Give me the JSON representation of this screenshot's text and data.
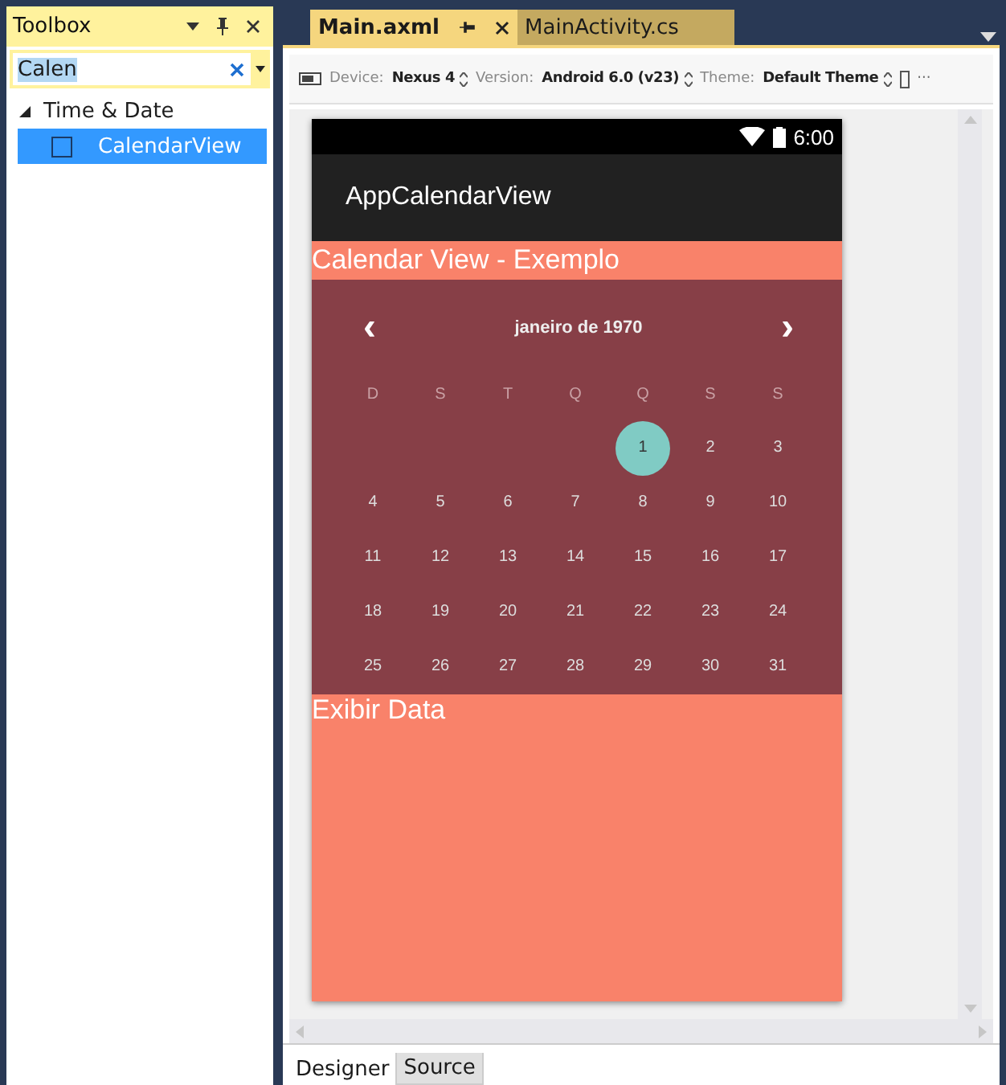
{
  "toolbox": {
    "title": "Toolbox",
    "search": {
      "value": "Calen"
    },
    "tree": [
      {
        "label": "Time & Date",
        "expanded": true,
        "children": [
          {
            "label": "CalendarView",
            "selected": true
          }
        ]
      }
    ]
  },
  "editor_tabs": [
    {
      "label": "Main.axml",
      "selected": true
    },
    {
      "label": "MainActivity.cs",
      "selected": false
    }
  ],
  "toolbar": {
    "device_label": "Device:",
    "device": "Nexus 4",
    "version_label": "Version:",
    "version": "Android 6.0 (v23)",
    "theme_label": "Theme:",
    "theme": "Default Theme",
    "more": "···"
  },
  "phone": {
    "time": "6:00",
    "app_title": "AppCalendarView",
    "heading": "Calendar View - Exemplo",
    "calendar": {
      "month": "janeiro de 1970",
      "prev": "‹",
      "next": "›",
      "weekdays": [
        "D",
        "S",
        "T",
        "Q",
        "Q",
        "S",
        "S"
      ],
      "weeks": [
        [
          {
            "day": "1",
            "selected": true
          },
          {
            "day": "2",
            "selected": false
          },
          {
            "day": "3",
            "selected": false
          }
        ],
        [
          {
            "day": "4",
            "selected": false
          },
          {
            "day": "5",
            "selected": false
          },
          {
            "day": "6",
            "selected": false
          },
          {
            "day": "7",
            "selected": false
          },
          {
            "day": "8",
            "selected": false
          },
          {
            "day": "9",
            "selected": false
          },
          {
            "day": "10",
            "selected": false
          }
        ],
        [
          {
            "day": "11",
            "selected": false
          },
          {
            "day": "12",
            "selected": false
          },
          {
            "day": "13",
            "selected": false
          },
          {
            "day": "14",
            "selected": false
          },
          {
            "day": "15",
            "selected": false
          },
          {
            "day": "16",
            "selected": false
          },
          {
            "day": "17",
            "selected": false
          }
        ],
        [
          {
            "day": "18",
            "selected": false
          },
          {
            "day": "19",
            "selected": false
          },
          {
            "day": "20",
            "selected": false
          },
          {
            "day": "21",
            "selected": false
          },
          {
            "day": "22",
            "selected": false
          },
          {
            "day": "23",
            "selected": false
          },
          {
            "day": "24",
            "selected": false
          }
        ],
        [
          {
            "day": "25",
            "selected": false
          },
          {
            "day": "26",
            "selected": false
          },
          {
            "day": "27",
            "selected": false
          },
          {
            "day": "28",
            "selected": false
          },
          {
            "day": "29",
            "selected": false
          },
          {
            "day": "30",
            "selected": false
          },
          {
            "day": "31",
            "selected": false
          }
        ]
      ]
    },
    "footer_text": "Exibir Data"
  },
  "bottom_tabs": [
    {
      "label": "Designer",
      "selected": true
    },
    {
      "label": "Source",
      "selected": false
    }
  ]
}
